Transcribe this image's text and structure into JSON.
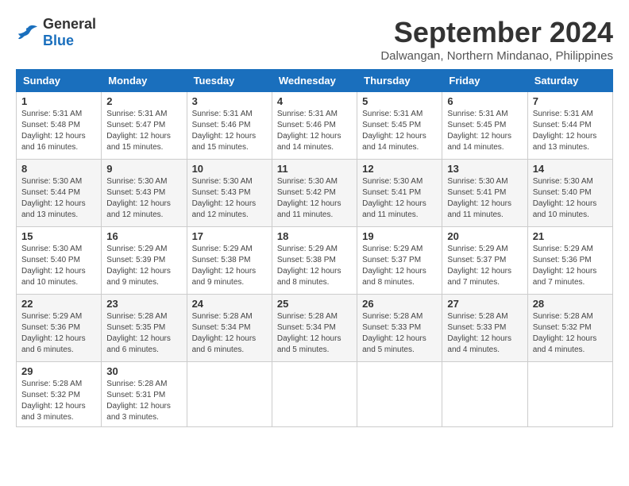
{
  "header": {
    "logo_general": "General",
    "logo_blue": "Blue",
    "month_year": "September 2024",
    "location": "Dalwangan, Northern Mindanao, Philippines"
  },
  "weekdays": [
    "Sunday",
    "Monday",
    "Tuesday",
    "Wednesday",
    "Thursday",
    "Friday",
    "Saturday"
  ],
  "weeks": [
    [
      {
        "num": "1",
        "sunrise": "5:31 AM",
        "sunset": "5:48 PM",
        "daylight": "12 hours and 16 minutes."
      },
      {
        "num": "2",
        "sunrise": "5:31 AM",
        "sunset": "5:47 PM",
        "daylight": "12 hours and 15 minutes."
      },
      {
        "num": "3",
        "sunrise": "5:31 AM",
        "sunset": "5:46 PM",
        "daylight": "12 hours and 15 minutes."
      },
      {
        "num": "4",
        "sunrise": "5:31 AM",
        "sunset": "5:46 PM",
        "daylight": "12 hours and 14 minutes."
      },
      {
        "num": "5",
        "sunrise": "5:31 AM",
        "sunset": "5:45 PM",
        "daylight": "12 hours and 14 minutes."
      },
      {
        "num": "6",
        "sunrise": "5:31 AM",
        "sunset": "5:45 PM",
        "daylight": "12 hours and 14 minutes."
      },
      {
        "num": "7",
        "sunrise": "5:31 AM",
        "sunset": "5:44 PM",
        "daylight": "12 hours and 13 minutes."
      }
    ],
    [
      {
        "num": "8",
        "sunrise": "5:30 AM",
        "sunset": "5:44 PM",
        "daylight": "12 hours and 13 minutes."
      },
      {
        "num": "9",
        "sunrise": "5:30 AM",
        "sunset": "5:43 PM",
        "daylight": "12 hours and 12 minutes."
      },
      {
        "num": "10",
        "sunrise": "5:30 AM",
        "sunset": "5:43 PM",
        "daylight": "12 hours and 12 minutes."
      },
      {
        "num": "11",
        "sunrise": "5:30 AM",
        "sunset": "5:42 PM",
        "daylight": "12 hours and 11 minutes."
      },
      {
        "num": "12",
        "sunrise": "5:30 AM",
        "sunset": "5:41 PM",
        "daylight": "12 hours and 11 minutes."
      },
      {
        "num": "13",
        "sunrise": "5:30 AM",
        "sunset": "5:41 PM",
        "daylight": "12 hours and 11 minutes."
      },
      {
        "num": "14",
        "sunrise": "5:30 AM",
        "sunset": "5:40 PM",
        "daylight": "12 hours and 10 minutes."
      }
    ],
    [
      {
        "num": "15",
        "sunrise": "5:30 AM",
        "sunset": "5:40 PM",
        "daylight": "12 hours and 10 minutes."
      },
      {
        "num": "16",
        "sunrise": "5:29 AM",
        "sunset": "5:39 PM",
        "daylight": "12 hours and 9 minutes."
      },
      {
        "num": "17",
        "sunrise": "5:29 AM",
        "sunset": "5:38 PM",
        "daylight": "12 hours and 9 minutes."
      },
      {
        "num": "18",
        "sunrise": "5:29 AM",
        "sunset": "5:38 PM",
        "daylight": "12 hours and 8 minutes."
      },
      {
        "num": "19",
        "sunrise": "5:29 AM",
        "sunset": "5:37 PM",
        "daylight": "12 hours and 8 minutes."
      },
      {
        "num": "20",
        "sunrise": "5:29 AM",
        "sunset": "5:37 PM",
        "daylight": "12 hours and 7 minutes."
      },
      {
        "num": "21",
        "sunrise": "5:29 AM",
        "sunset": "5:36 PM",
        "daylight": "12 hours and 7 minutes."
      }
    ],
    [
      {
        "num": "22",
        "sunrise": "5:29 AM",
        "sunset": "5:36 PM",
        "daylight": "12 hours and 6 minutes."
      },
      {
        "num": "23",
        "sunrise": "5:28 AM",
        "sunset": "5:35 PM",
        "daylight": "12 hours and 6 minutes."
      },
      {
        "num": "24",
        "sunrise": "5:28 AM",
        "sunset": "5:34 PM",
        "daylight": "12 hours and 6 minutes."
      },
      {
        "num": "25",
        "sunrise": "5:28 AM",
        "sunset": "5:34 PM",
        "daylight": "12 hours and 5 minutes."
      },
      {
        "num": "26",
        "sunrise": "5:28 AM",
        "sunset": "5:33 PM",
        "daylight": "12 hours and 5 minutes."
      },
      {
        "num": "27",
        "sunrise": "5:28 AM",
        "sunset": "5:33 PM",
        "daylight": "12 hours and 4 minutes."
      },
      {
        "num": "28",
        "sunrise": "5:28 AM",
        "sunset": "5:32 PM",
        "daylight": "12 hours and 4 minutes."
      }
    ],
    [
      {
        "num": "29",
        "sunrise": "5:28 AM",
        "sunset": "5:32 PM",
        "daylight": "12 hours and 3 minutes."
      },
      {
        "num": "30",
        "sunrise": "5:28 AM",
        "sunset": "5:31 PM",
        "daylight": "12 hours and 3 minutes."
      },
      null,
      null,
      null,
      null,
      null
    ]
  ]
}
